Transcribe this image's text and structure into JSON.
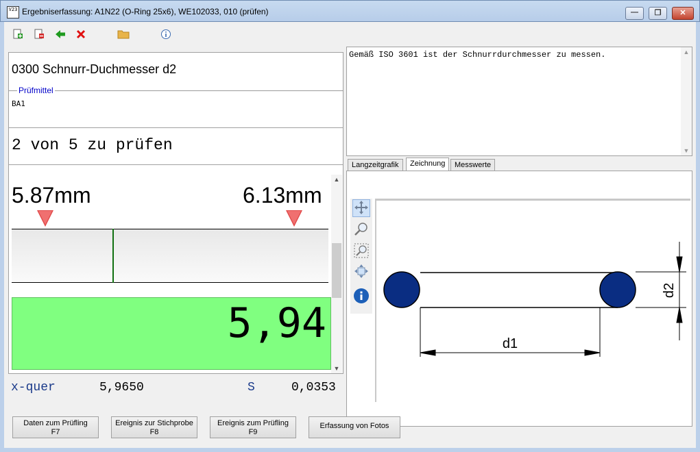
{
  "window": {
    "icon_text": "V23",
    "title": "Ergebniserfassung: A1N22 (O-Ring 25x6), WE102033, 010 (prüfen)",
    "minimize_glyph": "—",
    "maximize_glyph": "❐",
    "close_glyph": "✕"
  },
  "toolbar": {
    "icons": [
      "add-icon",
      "remove-icon",
      "back-arrow-icon",
      "delete-icon",
      "folder-icon",
      "info-icon"
    ]
  },
  "characteristic": {
    "title": "0300 Schnurr-Duchmesser d2",
    "pruefmittel_label": "Prüfmittel",
    "pruefmittel_value": "BA1",
    "progress_text": "2 von 5 zu prüfen",
    "lower_limit": "5.87mm",
    "upper_limit": "6.13mm",
    "measured_value": "5,94"
  },
  "stats": {
    "xbar_label": "x-quer",
    "xbar_value": "5,9650",
    "s_label": "S",
    "s_value": "0,0353"
  },
  "note": {
    "text": "Gemäß ISO 3601 ist der Schnurrdurchmesser zu messen."
  },
  "tabs": [
    {
      "label": "Langzeitgrafik",
      "active": false
    },
    {
      "label": "Zeichnung",
      "active": true
    },
    {
      "label": "Messwerte",
      "active": false
    }
  ],
  "drawing": {
    "d1_label": "d1",
    "d2_label": "d2",
    "accent_color": "#0a2d82"
  },
  "buttons": {
    "daten_line1": "Daten zum Prüfling",
    "daten_line2": "F7",
    "stichprobe_line1": "Ereignis zur Stichprobe",
    "stichprobe_line2": "F8",
    "pruefling_line1": "Ereignis zum Prüfling",
    "pruefling_line2": "F9",
    "fotos": "Erfassung von Fotos"
  }
}
